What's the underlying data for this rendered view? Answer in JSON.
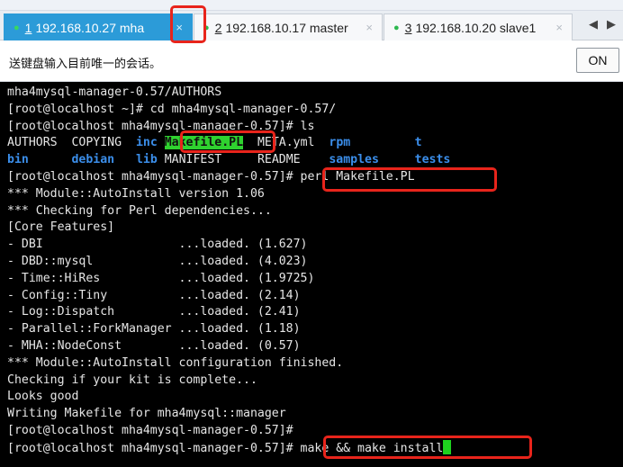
{
  "tabs": [
    {
      "number": "1",
      "title": "192.168.10.27 mha",
      "active": true
    },
    {
      "number": "2",
      "title": "192.168.10.17 master",
      "active": false
    },
    {
      "number": "3",
      "title": "192.168.10.20 slave1",
      "active": false
    }
  ],
  "tab_close_glyph": "×",
  "tab_dot_glyph": "●",
  "nav": {
    "prev": "◀",
    "next": "▶"
  },
  "send_bar": {
    "message": "送键盘输入目前唯一的会话。",
    "toggle_label": "ON"
  },
  "terminal": {
    "lines": [
      {
        "text": "mha4mysql-manager-0.57/AUTHORS"
      },
      {
        "prompt": "[root@localhost ~]# ",
        "command": "cd mha4mysql-manager-0.57/"
      },
      {
        "prompt": "[root@localhost mha4mysql-manager-0.57]# ",
        "command": "ls"
      },
      {
        "ls_row": 1
      },
      {
        "ls_row": 2
      },
      {
        "prompt": "[root@localhost mha4mysql-manager-0.57]# ",
        "command": "perl Makefile.PL"
      },
      {
        "text": "*** Module::AutoInstall version 1.06"
      },
      {
        "text": "*** Checking for Perl dependencies..."
      },
      {
        "text": "[Core Features]"
      },
      {
        "text": "- DBI                   ...loaded. (1.627)"
      },
      {
        "text": "- DBD::mysql            ...loaded. (4.023)"
      },
      {
        "text": "- Time::HiRes           ...loaded. (1.9725)"
      },
      {
        "text": "- Config::Tiny          ...loaded. (2.14)"
      },
      {
        "text": "- Log::Dispatch         ...loaded. (2.41)"
      },
      {
        "text": "- Parallel::ForkManager ...loaded. (1.18)"
      },
      {
        "text": "- MHA::NodeConst        ...loaded. (0.57)"
      },
      {
        "text": "*** Module::AutoInstall configuration finished."
      },
      {
        "text": "Checking if your kit is complete..."
      },
      {
        "text": "Looks good"
      },
      {
        "text": "Writing Makefile for mha4mysql::manager"
      },
      {
        "prompt": "[root@localhost mha4mysql-manager-0.57]# ",
        "command": ""
      },
      {
        "prompt": "[root@localhost mha4mysql-manager-0.57]# ",
        "command": "make && make install"
      }
    ],
    "ls_row1": [
      "AUTHORS",
      "COPYING",
      "inc",
      "Makefile.PL",
      "META.yml",
      "rpm",
      "t"
    ],
    "ls_row2": [
      "bin",
      "debian",
      "lib",
      "MANIFEST",
      "README",
      "samples",
      "tests"
    ],
    "colors": {
      "directory": "#3b8eea",
      "executable": "#2fd22f",
      "text": "#e6e6e6",
      "highlight": "#e8241b"
    }
  }
}
